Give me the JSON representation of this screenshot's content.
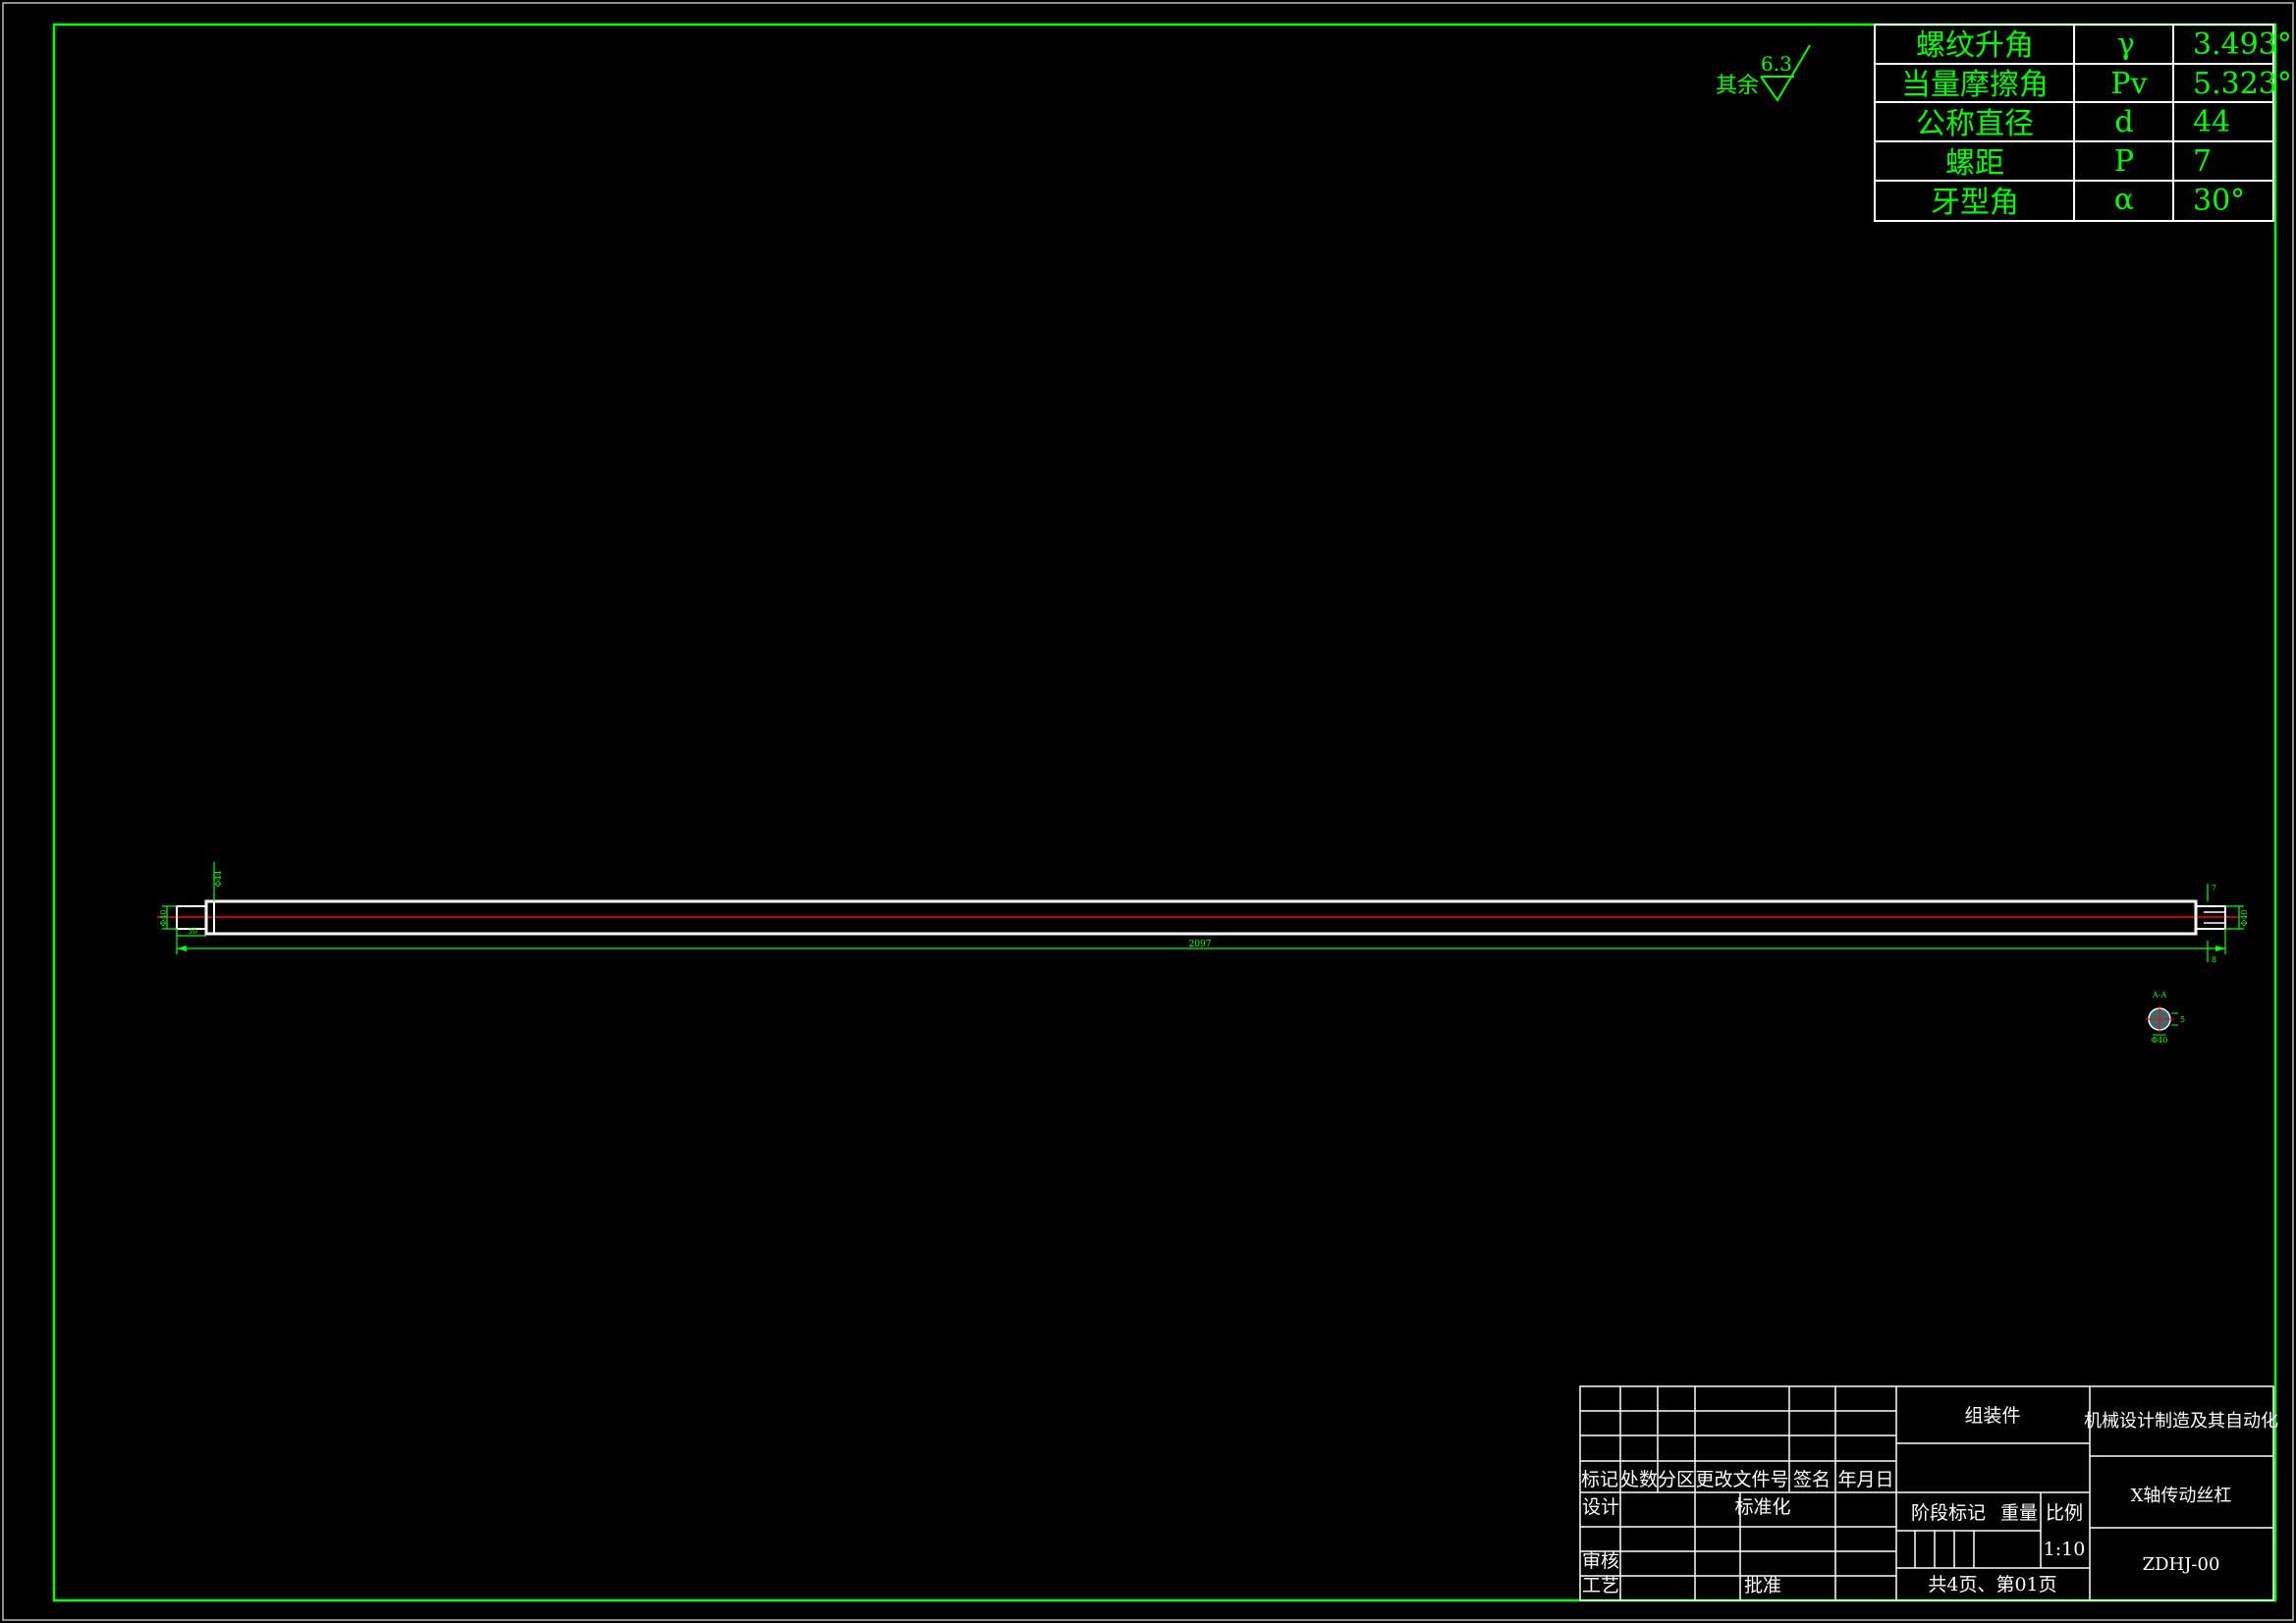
{
  "colors": {
    "background": "#000000",
    "frame": "#00ff00",
    "part_outline": "#ffffff",
    "centerline": "#ff0000",
    "dimension": "#00ff00",
    "section_fill": "#3a6a6a"
  },
  "roughness_note": {
    "label": "其余",
    "value": "6.3"
  },
  "parameter_table": [
    {
      "name": "螺纹升角",
      "symbol": "γ",
      "value": "3.493°"
    },
    {
      "name": "当量摩擦角",
      "symbol": "Pv",
      "value": "5.323°"
    },
    {
      "name": "公称直径",
      "symbol": "d",
      "value": "44"
    },
    {
      "name": "螺距",
      "symbol": "P",
      "value": "7"
    },
    {
      "name": "牙型角",
      "symbol": "α",
      "value": "30°"
    }
  ],
  "drawing": {
    "overall_length": "2097",
    "left_step_length": "30",
    "left_step_diameter": "Φ40",
    "left_shoulder_diameter": "Φ44",
    "right_step_diameter": "Φ40",
    "right_key_a": "7",
    "right_key_b": "8",
    "section_label": "A-A",
    "section_width": "5",
    "section_diameter": "Φ40"
  },
  "title_block": {
    "header_labels": [
      "标记",
      "处数",
      "分区",
      "更改文件号",
      "签名",
      "年月日"
    ],
    "design_label": "设计",
    "standardize_label": "标准化",
    "review_label": "审核",
    "process_label": "工艺",
    "approve_label": "批准",
    "assembly_label": "组装件",
    "stage_label": "阶段标记",
    "weight_label": "重量",
    "scale_label": "比例",
    "scale_value": "1:10",
    "sheets": "共4页、第01页",
    "school": "机械设计制造及其自动化",
    "part_name": "X轴传动丝杠",
    "drawing_number": "ZDHJ-00"
  }
}
